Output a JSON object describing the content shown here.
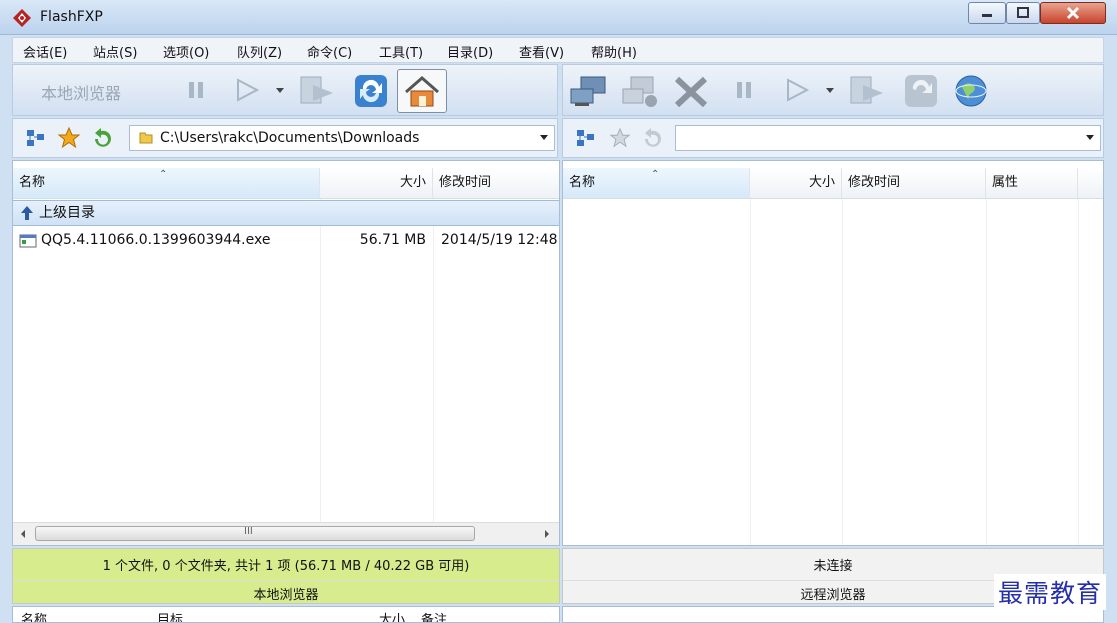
{
  "window": {
    "title": "FlashFXP"
  },
  "menu": [
    "会话(E)",
    "站点(S)",
    "选项(O)",
    "队列(Z)",
    "命令(C)",
    "工具(T)",
    "目录(D)",
    "查看(V)",
    "帮助(H)"
  ],
  "left_toolbar": {
    "label": "本地浏览器"
  },
  "left_address": {
    "path": "C:\\Users\\rakc\\Documents\\Downloads"
  },
  "right_address": {
    "path": ""
  },
  "left_columns": {
    "name": "名称",
    "size": "大小",
    "modified": "修改时间"
  },
  "right_columns": {
    "name": "名称",
    "size": "大小",
    "modified": "修改时间",
    "attributes": "属性"
  },
  "parent_dir": "上级目录",
  "files": [
    {
      "name": "QQ5.4.11066.0.1399603944.exe",
      "size": "56.71 MB",
      "modified": "2014/5/19 12:48"
    }
  ],
  "left_status": {
    "summary": "1 个文件, 0 个文件夹, 共计 1 项 (56.71 MB / 40.22 GB 可用)",
    "pane_name": "本地浏览器"
  },
  "right_status": {
    "summary": "未连接",
    "pane_name": "远程浏览器"
  },
  "queue_columns": {
    "name": "名称",
    "target": "目标",
    "size": "大小",
    "note": "备注"
  },
  "scrollbar_grip": "III",
  "watermark": "最需教育",
  "colors": {
    "local_status_bg": "#d7ec8c",
    "title_bg": "#bcd3ee",
    "close_red": "#c8442d"
  }
}
